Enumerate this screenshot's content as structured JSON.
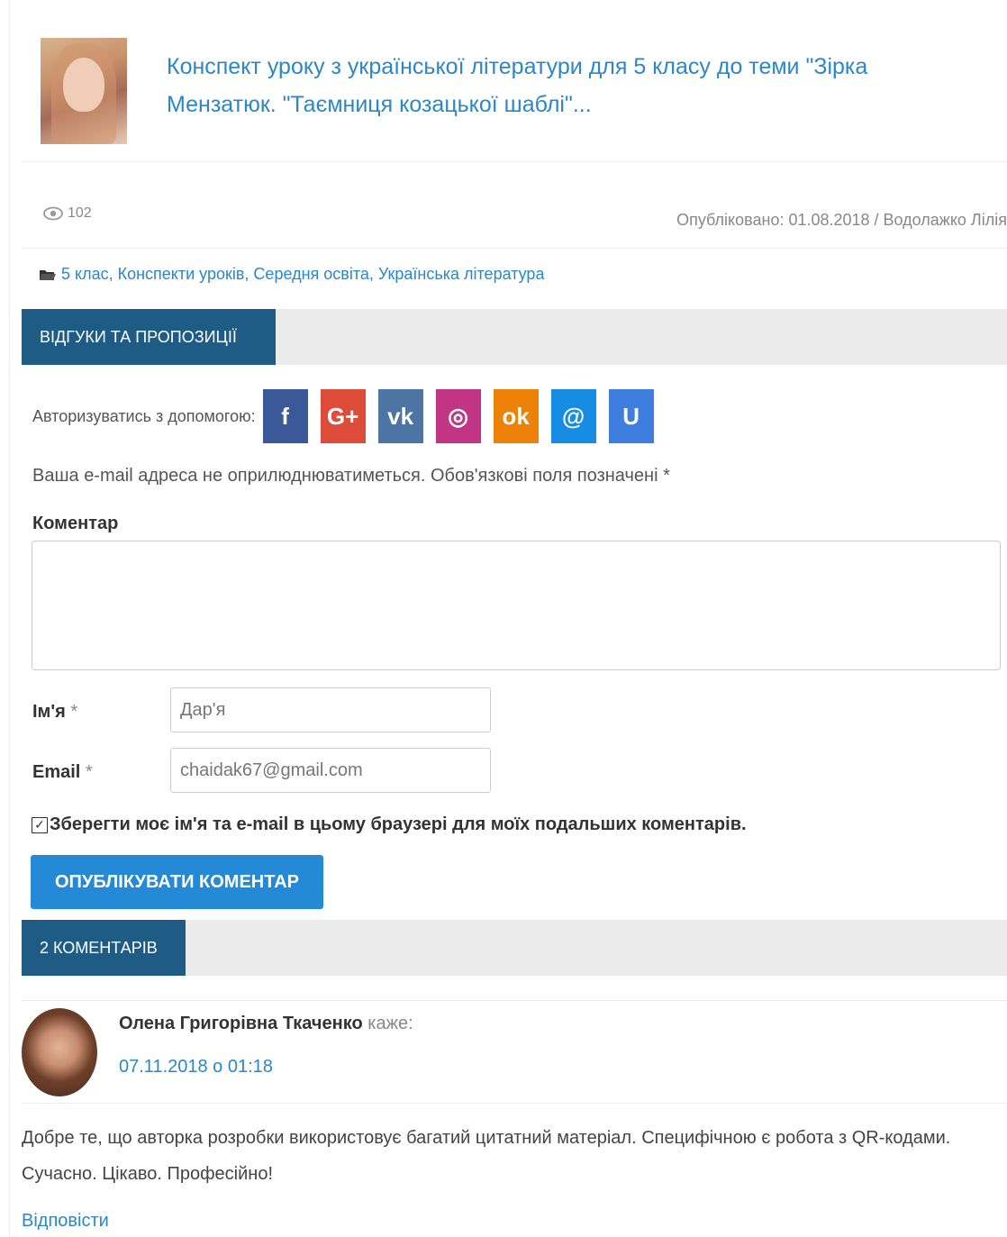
{
  "post": {
    "title": "Конспект уроку з української літератури для 5 класу до теми \"Зірка Мензатюк. \"Таємниця козацької шаблі\"...",
    "views": "102",
    "published": "Опубліковано: 01.08.2018 / Водолажко Лілія",
    "categories": "5 клас, Конспекти уроків, Середня освіта, Українська література"
  },
  "feedback": {
    "section_title": "ВІДГУКИ ТА ПРОПОЗИЦІЇ",
    "auth_label": "Авторизуватись з допомогою:",
    "social": [
      {
        "icon": "facebook-icon",
        "glyph": "f",
        "color": "#3b5998"
      },
      {
        "icon": "google-plus-icon",
        "glyph": "G+",
        "color": "#dd4b39"
      },
      {
        "icon": "vk-icon",
        "glyph": "vk",
        "color": "#4c75a3"
      },
      {
        "icon": "instagram-icon",
        "glyph": "◎",
        "color": "#c13584"
      },
      {
        "icon": "odnoklassniki-icon",
        "glyph": "ok",
        "color": "#ee8208"
      },
      {
        "icon": "mailru-icon",
        "glyph": "@",
        "color": "#168de2"
      },
      {
        "icon": "ukrnet-icon",
        "glyph": "U",
        "color": "#3d7ee0"
      }
    ],
    "notice": "Ваша e-mail адреса не оприлюднюватиметься. Обов'язкові поля позначені *",
    "comment_label": "Коментар",
    "name_label": "Ім'я",
    "email_label": "Email",
    "required_mark": "*",
    "name_value": "Дар'я",
    "email_value": "chaidak67@gmail.com",
    "remember_label": "Зберегти моє ім'я та e-mail в цьому браузері для моїх подальших коментарів.",
    "remember_checked": true,
    "submit_label": "ОПУБЛІКУВАТИ КОМЕНТАР"
  },
  "comments": {
    "section_title": "2 КОМЕНТАРІВ",
    "items": [
      {
        "author": "Олена Григорівна Ткаченко",
        "says": "каже:",
        "date": "07.11.2018 о 01:18",
        "text": "Добре те, що авторка розробки використовує багатий цитатний матеріал. Специфічною є робота з QR-кодами. Сучасно. Цікаво. Професійно!",
        "reply_label": "Відповісти"
      }
    ]
  },
  "colors": {
    "link": "#2a87c8",
    "section_tab": "#1f5c85",
    "button": "#2489d6"
  }
}
